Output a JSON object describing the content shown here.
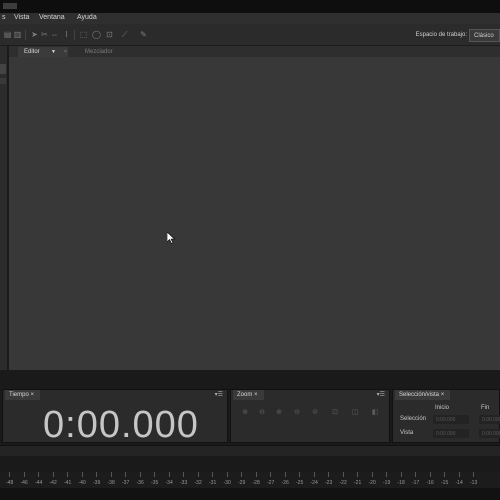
{
  "menubar": {
    "items": [
      {
        "label": "s"
      },
      {
        "label": "Vista"
      },
      {
        "label": "Ventana"
      },
      {
        "label": "Ayuda"
      }
    ]
  },
  "toolbar": {
    "workspace_label": "Espacio de trabajo:",
    "workspace_value": "Clásico",
    "tools": [
      "waveform-tool-icon",
      "move-tool-icon",
      "razor-tool-icon",
      "slip-tool-icon",
      "time-selection-icon",
      "marquee-icon",
      "lasso-icon",
      "brush-icon",
      "spot-heal-icon"
    ]
  },
  "editor": {
    "tabs": [
      {
        "label": "Editor",
        "active": true
      },
      {
        "label": "Mezclador",
        "active": false
      }
    ]
  },
  "panels": {
    "tiempo": {
      "title": "Tiempo",
      "time": "0:00.000"
    },
    "zoom": {
      "title": "Zoom"
    },
    "seleccion": {
      "title": "Selección/vista",
      "col_inicio": "Inicio",
      "col_fin": "Fin",
      "row_seleccion": "Selección",
      "row_vista": "Vista",
      "sel_start": "0:00.000",
      "sel_end": "0:00.000",
      "view_start": "0:00.000",
      "view_end": "0:00.000"
    }
  },
  "ruler": {
    "labels": [
      "-48",
      "-46",
      "-44",
      "-42",
      "-41",
      "-40",
      "-39",
      "-38",
      "-37",
      "-36",
      "-35",
      "-34",
      "-33",
      "-32",
      "-31",
      "-30",
      "-29",
      "-28",
      "-27",
      "-26",
      "-25",
      "-24",
      "-23",
      "-22",
      "-21",
      "-20",
      "-19",
      "-18",
      "-17",
      "-16",
      "-15",
      "-14",
      "-13"
    ]
  }
}
